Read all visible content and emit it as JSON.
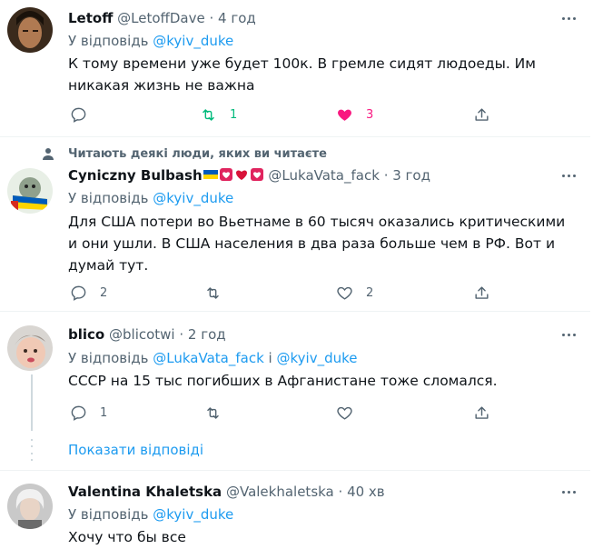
{
  "tweets": [
    {
      "name": "Letoff",
      "handle": "@LetoffDave",
      "time": "· 4 год",
      "reply_prefix": "У відповідь",
      "reply_to": "@kyiv_duke",
      "text": "К тому времени уже будет 100к. В гремле сидят людоеды. Им никакая жизнь не важна",
      "replies": "",
      "retweets": "1",
      "likes": "3",
      "liked": true
    },
    {
      "social_context": "Читають деякі люди, яких ви читаєте",
      "name": "Cyniczny Bulbash",
      "handle": "@LukaVata_fack",
      "time": "· 3 год",
      "reply_prefix": "У відповідь",
      "reply_to": "@kyiv_duke",
      "text": "Для США потери во Вьетнаме в 60 тысяч оказались критическими и они ушли. В США населения в два раза больше чем в РФ. Вот и думай тут.",
      "replies": "2",
      "retweets": "",
      "likes": "2"
    },
    {
      "name": "blico",
      "handle": "@blicotwi",
      "time": "· 2 год",
      "reply_prefix": "У відповідь",
      "reply_to": "@LukaVata_fack",
      "reply_and": "і",
      "reply_to_2": "@kyiv_duke",
      "text": "СССР на 15 тыс погибших в Афганистане тоже сломался.",
      "replies": "1",
      "retweets": "",
      "likes": ""
    },
    {
      "name": "Valentina Khaletska",
      "handle": "@Valekhaletska",
      "time": "· 40 хв",
      "reply_prefix": "У відповідь",
      "reply_to": "@kyiv_duke",
      "text": "Хочу что бы все"
    }
  ],
  "show_replies": "Показати відповіді",
  "colors": {
    "accent": "#1d9bf0",
    "like": "#f91880",
    "retweet": "#00ba7c",
    "muted": "#536471"
  },
  "icons": [
    "reply-icon",
    "retweet-icon",
    "like-icon",
    "share-icon",
    "more-icon",
    "person-icon"
  ]
}
